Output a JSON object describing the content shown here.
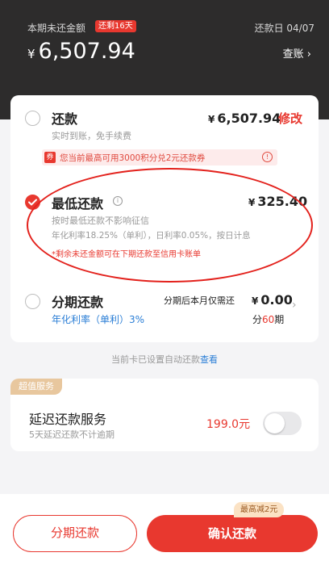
{
  "header": {
    "label": "本期未还金额",
    "badge": "还剩16天",
    "due_date": "还款日 04/07",
    "currency": "¥",
    "amount": "6,507.94",
    "bill_link": "查账 ›"
  },
  "options": {
    "full": {
      "title": "还款",
      "subtitle": "实时到账，免手续费",
      "currency": "¥",
      "amount": "6,507.94",
      "modify": "修改",
      "coupon_tag": "券",
      "coupon_text": "您当前最高可用3000积分兑2元还款券",
      "coupon_info": "!"
    },
    "minimum": {
      "title": "最低还款",
      "info": "i",
      "currency": "¥",
      "amount": "325.40",
      "line1": "按时最低还款不影响征信",
      "line2": "年化利率18.25%（单利），日利率0.05%，按日计息",
      "note": "*剩余未还金额可在下期还款至信用卡账单",
      "selected": true
    },
    "installment": {
      "title": "分期还款",
      "rate": "年化利率（单利）3%",
      "pay_label": "分期后本月仅需还",
      "currency": "¥",
      "amount": "0.00",
      "periods_prefix": "分",
      "periods_number": "60",
      "periods_suffix": "期"
    }
  },
  "auto_note": {
    "text": "当前卡已设置自动还款",
    "link": "查看"
  },
  "service": {
    "tag": "超值服务",
    "title": "延迟还款服务",
    "subtitle": "5天延迟还款不计逾期",
    "price": "199.0元",
    "enabled": false
  },
  "bottom": {
    "installment_button": "分期还款",
    "confirm_button": "确认还款",
    "promo": "最高减2元"
  },
  "colors": {
    "accent": "#e8382f",
    "header_bg": "#2d2c2c",
    "link": "#2a7ed6"
  }
}
